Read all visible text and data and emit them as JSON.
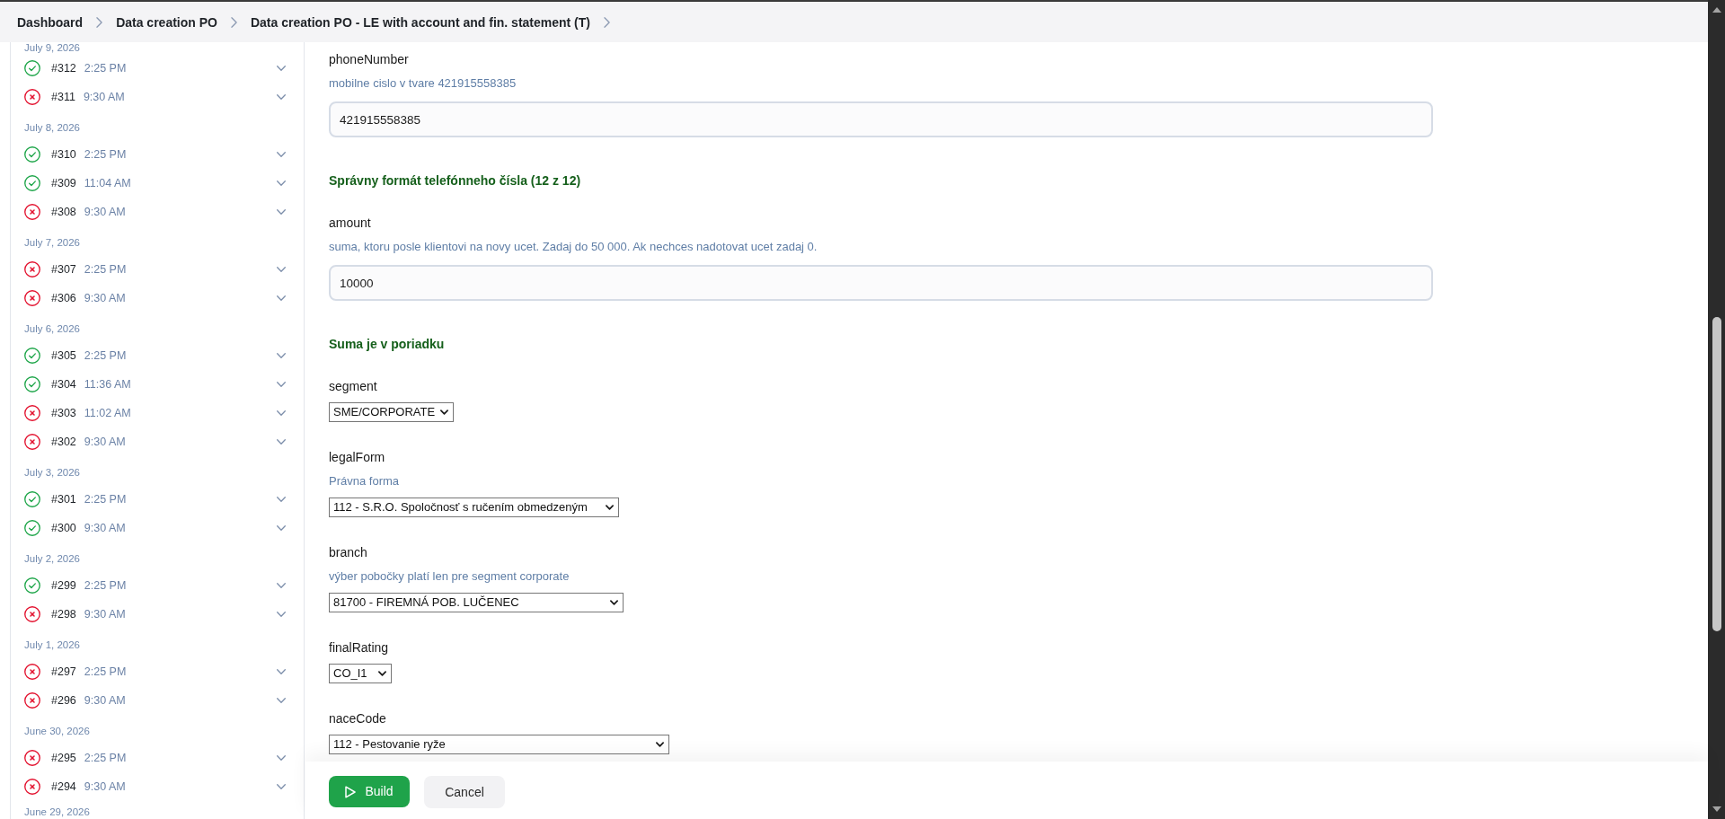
{
  "breadcrumb": [
    {
      "label": "Dashboard"
    },
    {
      "label": "Data creation PO"
    },
    {
      "label": "Data creation PO - LE with account and fin. statement (T)"
    }
  ],
  "build_history": [
    {
      "date": "July 9, 2026",
      "builds": [
        {
          "number": "#312",
          "time": "2:25 PM",
          "success": true
        },
        {
          "number": "#311",
          "time": "9:30 AM",
          "success": false
        }
      ]
    },
    {
      "date": "July 8, 2026",
      "builds": [
        {
          "number": "#310",
          "time": "2:25 PM",
          "success": true
        },
        {
          "number": "#309",
          "time": "11:04 AM",
          "success": true
        },
        {
          "number": "#308",
          "time": "9:30 AM",
          "success": false
        }
      ]
    },
    {
      "date": "July 7, 2026",
      "builds": [
        {
          "number": "#307",
          "time": "2:25 PM",
          "success": false
        },
        {
          "number": "#306",
          "time": "9:30 AM",
          "success": false
        }
      ]
    },
    {
      "date": "July 6, 2026",
      "builds": [
        {
          "number": "#305",
          "time": "2:25 PM",
          "success": true
        },
        {
          "number": "#304",
          "time": "11:36 AM",
          "success": true
        },
        {
          "number": "#303",
          "time": "11:02 AM",
          "success": false
        },
        {
          "number": "#302",
          "time": "9:30 AM",
          "success": false
        }
      ]
    },
    {
      "date": "July 3, 2026",
      "builds": [
        {
          "number": "#301",
          "time": "2:25 PM",
          "success": true
        },
        {
          "number": "#300",
          "time": "9:30 AM",
          "success": true
        }
      ]
    },
    {
      "date": "July 2, 2026",
      "builds": [
        {
          "number": "#299",
          "time": "2:25 PM",
          "success": true
        },
        {
          "number": "#298",
          "time": "9:30 AM",
          "success": false
        }
      ]
    },
    {
      "date": "July 1, 2026",
      "builds": [
        {
          "number": "#297",
          "time": "2:25 PM",
          "success": false
        },
        {
          "number": "#296",
          "time": "9:30 AM",
          "success": false
        }
      ]
    },
    {
      "date": "June 30, 2026",
      "builds": [
        {
          "number": "#295",
          "time": "2:25 PM",
          "success": false
        },
        {
          "number": "#294",
          "time": "9:30 AM",
          "success": false
        }
      ]
    },
    {
      "date": "June 29, 2026"
    }
  ],
  "form": {
    "fields": [
      {
        "kind": "text",
        "name": "phoneNumber",
        "description": "mobilne cislo v tvare 421915558385",
        "value": "421915558385",
        "validation": "Správny formát telefónneho čísla (12 z 12)"
      },
      {
        "kind": "text",
        "name": "amount",
        "description": "suma, ktoru posle klientovi na novy ucet. Zadaj do 50 000. Ak nechces nadotovat ucet zadaj 0.",
        "value": "10000",
        "validation": "Suma je v poriadku"
      },
      {
        "kind": "select",
        "name": "segment",
        "value": "SME/CORPORATE"
      },
      {
        "kind": "select",
        "name": "legalForm",
        "description": "Právna forma",
        "value": "112 - S.R.O. Spoločnosť s ručením obmedzeným"
      },
      {
        "kind": "select",
        "name": "branch",
        "description": "výber pobočky platí len pre segment corporate",
        "value": "81700 - FIREMNÁ POB. LUČENEC"
      },
      {
        "kind": "select",
        "name": "finalRating",
        "value": "CO_I1"
      },
      {
        "kind": "select",
        "name": "naceCode",
        "value": "112 - Pestovanie ryže"
      }
    ]
  },
  "actions": [
    {
      "kind": "primary",
      "label": "Build"
    },
    {
      "kind": "secondary",
      "label": "Cancel"
    }
  ]
}
